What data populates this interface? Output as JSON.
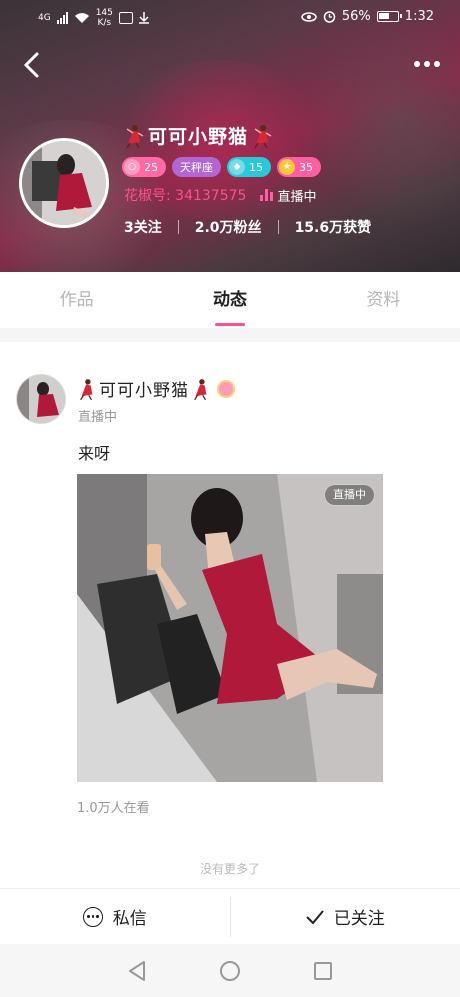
{
  "status_bar": {
    "network": "4G",
    "speed_value": "145",
    "speed_unit": "K/s",
    "battery": "56%",
    "time": "1:32"
  },
  "profile": {
    "name": "可可小野猫",
    "badges": [
      {
        "value": "25",
        "color": "#ff6aa5",
        "icon": "user-level-icon"
      },
      {
        "value": "天秤座",
        "color": "#b266d6",
        "icon": "zodiac-tag"
      },
      {
        "value": "15",
        "color": "#29c9d9",
        "icon": "diamond-icon"
      },
      {
        "value": "35",
        "color": "#ff5fa2",
        "icon": "star-icon"
      }
    ],
    "id_label": "花椒号: 34137575",
    "live_label": "直播中",
    "stats": {
      "following": "3关注",
      "fans": "2.0万粉丝",
      "likes": "15.6万获赞"
    }
  },
  "tabs": [
    {
      "label": "作品",
      "active": false
    },
    {
      "label": "动态",
      "active": true
    },
    {
      "label": "资料",
      "active": false
    }
  ],
  "post": {
    "author": "可可小野猫",
    "status": "直播中",
    "text": "来呀",
    "image_badge": "直播中",
    "viewers": "1.0万人在看"
  },
  "footer_hint": "没有更多了",
  "actions": {
    "message": "私信",
    "followed": "已关注"
  },
  "colors": {
    "accent": "#ff4f8f",
    "header_bg": "#5a3a48"
  }
}
